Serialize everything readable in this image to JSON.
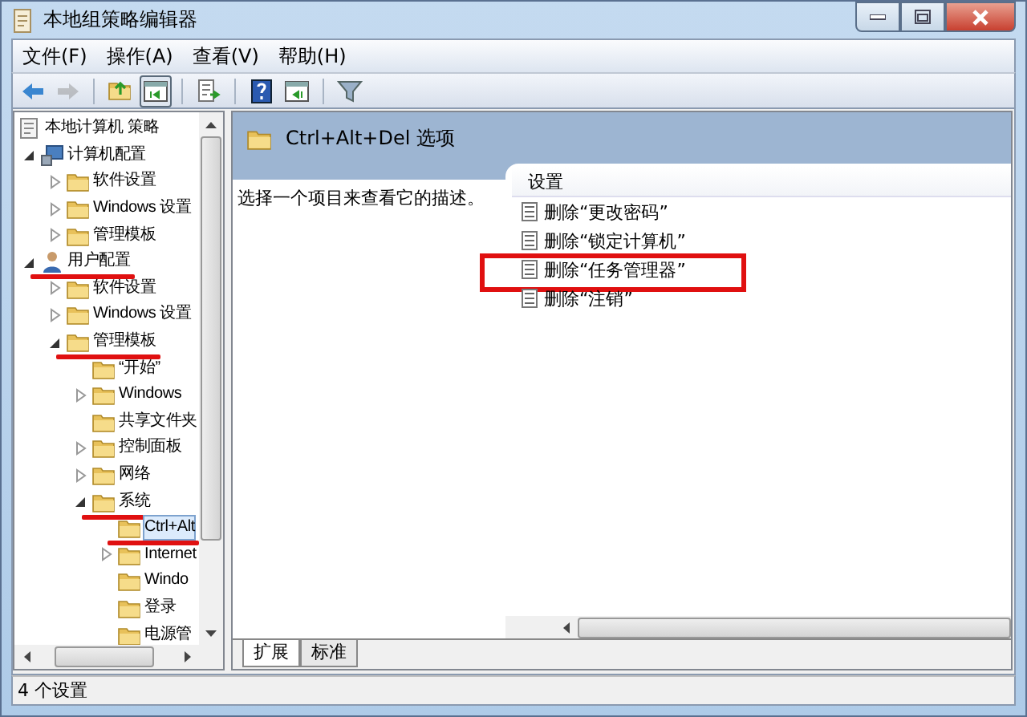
{
  "window": {
    "title": "本地组策略编辑器"
  },
  "menu": [
    "文件(F)",
    "操作(A)",
    "查看(V)",
    "帮助(H)"
  ],
  "toolbar": [
    [
      {
        "kind": "back",
        "disabled": false,
        "pressed": false
      },
      {
        "kind": "forward",
        "disabled": true,
        "pressed": false
      }
    ],
    [
      {
        "kind": "up",
        "disabled": false,
        "pressed": false
      },
      {
        "kind": "tree",
        "disabled": false,
        "pressed": true
      }
    ],
    [
      {
        "kind": "export",
        "disabled": false,
        "pressed": false
      }
    ],
    [
      {
        "kind": "help",
        "disabled": false,
        "pressed": false
      },
      {
        "kind": "pane",
        "disabled": false,
        "pressed": false
      }
    ],
    [
      {
        "kind": "filter",
        "disabled": false,
        "pressed": false
      }
    ]
  ],
  "tree": [
    {
      "label": "本地计算机 策略",
      "kind": "policy",
      "selected": false,
      "annotated": false,
      "children": [
        {
          "label": "计算机配置",
          "kind": "computer",
          "expanded": true,
          "selected": false,
          "annotated": false,
          "children": [
            {
              "label": "软件设置",
              "kind": "folder",
              "expanded": false,
              "selected": false,
              "annotated": false
            },
            {
              "label": "Windows 设置",
              "kind": "folder",
              "expanded": false,
              "selected": false,
              "annotated": false
            },
            {
              "label": "管理模板",
              "kind": "folder",
              "expanded": false,
              "selected": false,
              "annotated": false
            }
          ]
        },
        {
          "label": "用户配置",
          "kind": "user",
          "expanded": true,
          "selected": false,
          "annotated": true,
          "children": [
            {
              "label": "软件设置",
              "kind": "folder",
              "expanded": false,
              "selected": false,
              "annotated": false
            },
            {
              "label": "Windows 设置",
              "kind": "folder",
              "expanded": false,
              "selected": false,
              "annotated": false
            },
            {
              "label": "管理模板",
              "kind": "folder",
              "expanded": true,
              "selected": false,
              "annotated": true,
              "children": [
                {
                  "label": "“开始”",
                  "kind": "folder",
                  "selected": false,
                  "annotated": false
                },
                {
                  "label": "Windows",
                  "kind": "folder",
                  "expanded": false,
                  "selected": false,
                  "annotated": false
                },
                {
                  "label": "共享文件夹",
                  "kind": "folder",
                  "selected": false,
                  "annotated": false
                },
                {
                  "label": "控制面板",
                  "kind": "folder",
                  "expanded": false,
                  "selected": false,
                  "annotated": false
                },
                {
                  "label": "网络",
                  "kind": "folder",
                  "expanded": false,
                  "selected": false,
                  "annotated": false
                },
                {
                  "label": "系统",
                  "kind": "folder",
                  "expanded": true,
                  "selected": false,
                  "annotated": true,
                  "children": [
                    {
                      "label": "Ctrl+Alt",
                      "kind": "folder",
                      "selected": true,
                      "annotated": true
                    },
                    {
                      "label": "Internet",
                      "kind": "folder",
                      "expanded": false,
                      "selected": false,
                      "annotated": false
                    },
                    {
                      "label": "Windo",
                      "kind": "folder",
                      "selected": false,
                      "annotated": false
                    },
                    {
                      "label": "登录",
                      "kind": "folder",
                      "selected": false,
                      "annotated": false
                    },
                    {
                      "label": "电源管",
                      "kind": "folder",
                      "selected": false,
                      "annotated": false
                    }
                  ]
                }
              ]
            }
          ]
        }
      ]
    }
  ],
  "details": {
    "title": "Ctrl+Alt+Del 选项",
    "description": "选择一个项目来查看它的描述。",
    "column": "设置",
    "rows": [
      {
        "label": "删除“更改密码”",
        "annotated": false
      },
      {
        "label": "删除“锁定计算机”",
        "annotated": false
      },
      {
        "label": "删除“任务管理器”",
        "annotated": true
      },
      {
        "label": "删除“注销”",
        "annotated": false
      }
    ],
    "tabs": [
      {
        "label": "扩展",
        "selected": true
      },
      {
        "label": "标准",
        "selected": false
      }
    ]
  },
  "status_bar": "4 个设置"
}
